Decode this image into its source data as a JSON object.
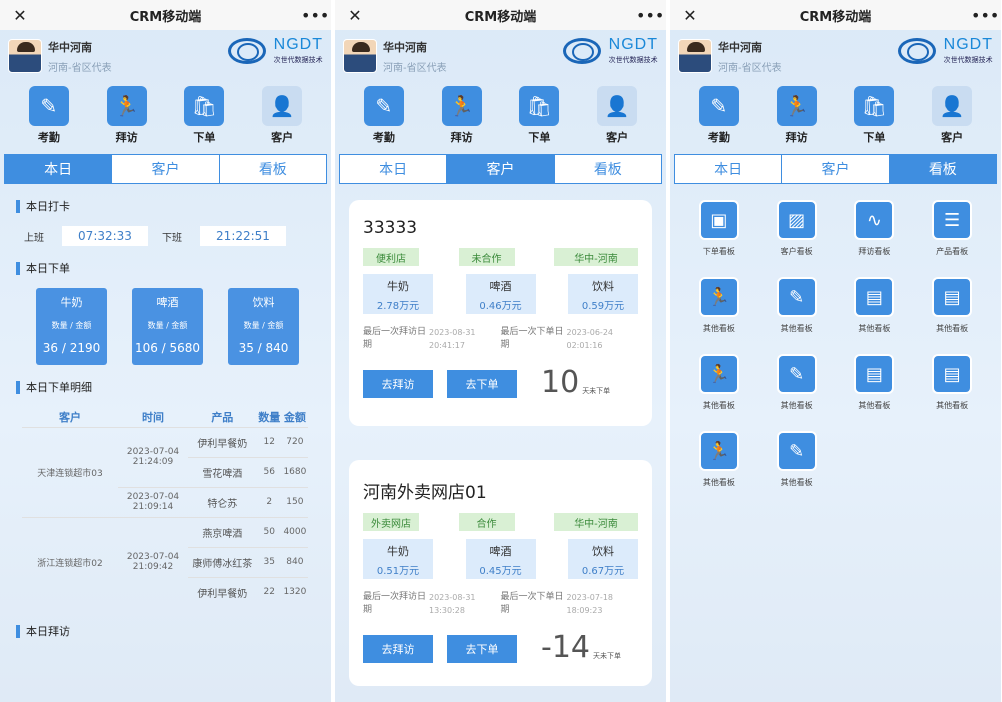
{
  "app": {
    "title": "CRM移动端",
    "close_glyph": "✕",
    "more_glyph": "•••"
  },
  "profile": {
    "name": "华中河南",
    "role": "河南-省区代表"
  },
  "logo": {
    "text": "NGDT",
    "subtitle": "次世代数据技术"
  },
  "quick_actions": [
    {
      "label": "考勤",
      "icon": "attendance-icon",
      "glyph": "✎"
    },
    {
      "label": "拜访",
      "icon": "runner-icon",
      "glyph": "🏃"
    },
    {
      "label": "下单",
      "icon": "bag-icon",
      "glyph": "🛍"
    },
    {
      "label": "客户",
      "icon": "person-icon",
      "glyph": "👤"
    }
  ],
  "tabs": [
    "本日",
    "客户",
    "看板"
  ],
  "today": {
    "punch_title": "本日打卡",
    "checkin_label": "上班",
    "checkin_time": "07:32:33",
    "checkout_label": "下班",
    "checkout_time": "21:22:51",
    "orders_title": "本日下单",
    "order_cards": [
      {
        "name": "牛奶",
        "sub": "数量 / 金额",
        "qty": "36",
        "amt": "2190"
      },
      {
        "name": "啤酒",
        "sub": "数量 / 金额",
        "qty": "106",
        "amt": "5680"
      },
      {
        "name": "饮料",
        "sub": "数量 / 金额",
        "qty": "35",
        "amt": "840"
      }
    ],
    "detail_title": "本日下单明细",
    "detail_headers": [
      "客户",
      "时间",
      "产品",
      "数量",
      "金额"
    ],
    "detail_rows": [
      {
        "customer": "天津连锁超市03",
        "time": "2023-07-04 21:24:09",
        "product": "伊利早餐奶",
        "qty": "12",
        "amt": "720"
      },
      {
        "customer": "",
        "time": "",
        "product": "雪花啤酒",
        "qty": "56",
        "amt": "1680"
      },
      {
        "customer": "",
        "time": "2023-07-04 21:09:14",
        "product": "特仑苏",
        "qty": "2",
        "amt": "150"
      },
      {
        "customer": "浙江连锁超市02",
        "time": "",
        "product": "燕京啤酒",
        "qty": "50",
        "amt": "4000"
      },
      {
        "customer": "",
        "time": "2023-07-04 21:09:42",
        "product": "康师傅冰红茶",
        "qty": "35",
        "amt": "840"
      },
      {
        "customer": "",
        "time": "",
        "product": "伊利早餐奶",
        "qty": "22",
        "amt": "1320"
      }
    ],
    "visit_title": "本日拜访"
  },
  "customers": [
    {
      "name": "33333",
      "tags": [
        "便利店",
        "未合作",
        "华中-河南"
      ],
      "products": [
        {
          "name": "牛奶",
          "value": "2.78万元"
        },
        {
          "name": "啤酒",
          "value": "0.46万元"
        },
        {
          "name": "饮料",
          "value": "0.59万元"
        }
      ],
      "last_visit_label": "最后一次拜访日期",
      "last_visit": "2023-08-31 20:41:17",
      "last_order_label": "最后一次下单日期",
      "last_order": "2023-06-24 02:01:16",
      "visit_btn": "去拜访",
      "order_btn": "去下单",
      "days": "10",
      "days_label": "天未下单"
    },
    {
      "name": "河南外卖网店01",
      "tags": [
        "外卖网店",
        "合作",
        "华中-河南"
      ],
      "products": [
        {
          "name": "牛奶",
          "value": "0.51万元"
        },
        {
          "name": "啤酒",
          "value": "0.45万元"
        },
        {
          "name": "饮料",
          "value": "0.67万元"
        }
      ],
      "last_visit_label": "最后一次拜访日期",
      "last_visit": "2023-08-31 13:30:28",
      "last_order_label": "最后一次下单日期",
      "last_order": "2023-07-18 18:09:23",
      "visit_btn": "去拜访",
      "order_btn": "去下单",
      "days": "-14",
      "days_label": "天未下单"
    }
  ],
  "boards": [
    {
      "label": "下单看板",
      "icon": "presentation-icon",
      "glyph": "▣"
    },
    {
      "label": "客户看板",
      "icon": "image-icon",
      "glyph": "▨"
    },
    {
      "label": "拜访看板",
      "icon": "trend-icon",
      "glyph": "∿"
    },
    {
      "label": "产品看板",
      "icon": "list-icon",
      "glyph": "☰"
    },
    {
      "label": "其他看板",
      "icon": "runner-icon",
      "glyph": "🏃"
    },
    {
      "label": "其他看板",
      "icon": "edit-person-icon",
      "glyph": "✎"
    },
    {
      "label": "其他看板",
      "icon": "id-card-icon",
      "glyph": "▤"
    },
    {
      "label": "其他看板",
      "icon": "id-card-icon",
      "glyph": "▤"
    },
    {
      "label": "其他看板",
      "icon": "runner-icon",
      "glyph": "🏃"
    },
    {
      "label": "其他看板",
      "icon": "edit-person-icon",
      "glyph": "✎"
    },
    {
      "label": "其他看板",
      "icon": "id-card-icon",
      "glyph": "▤"
    },
    {
      "label": "其他看板",
      "icon": "id-card-icon",
      "glyph": "▤"
    },
    {
      "label": "其他看板",
      "icon": "runner-icon",
      "glyph": "🏃"
    },
    {
      "label": "其他看板",
      "icon": "edit-person-icon",
      "glyph": "✎"
    }
  ]
}
